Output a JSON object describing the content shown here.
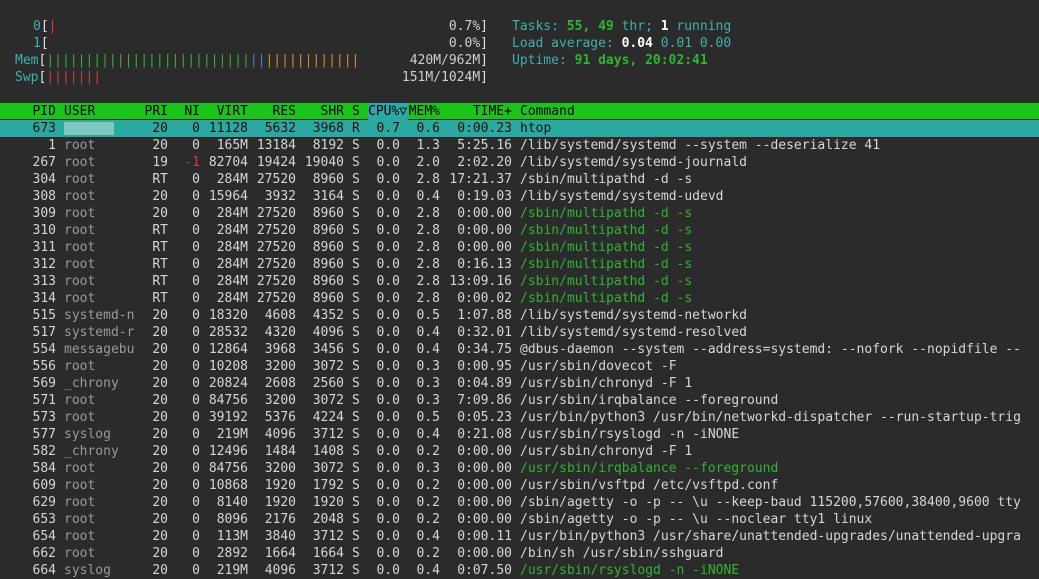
{
  "meters": {
    "cpu0": {
      "label": "0",
      "bar": "|",
      "value": "0.7%"
    },
    "cpu1": {
      "label": "1",
      "bar": "",
      "value": "0.0%"
    },
    "mem": {
      "label": "Mem",
      "bar_green": "||||||||||||||||||||||||||",
      "bar_blue": "||",
      "bar_orange": "||||||||||||",
      "value": "420M/962M"
    },
    "swp": {
      "label": "Swp",
      "bar": "|||||||",
      "value": "151M/1024M"
    }
  },
  "summary": {
    "tasks_label": "Tasks:",
    "tasks": "55,",
    "thr": "49",
    "thr_label": "thr;",
    "running": "1",
    "running_label": "running",
    "load_label": "Load average:",
    "load1": "0.04",
    "load5": "0.01",
    "load15": "0.00",
    "uptime_label": "Uptime:",
    "uptime": "91 days, 20:02:41"
  },
  "columns": {
    "pid": "PID",
    "user": "USER",
    "pri": "PRI",
    "ni": "NI",
    "virt": "VIRT",
    "res": "RES",
    "shr": "SHR",
    "s": "S",
    "cpu": "CPU%▽",
    "mem": "MEM%",
    "time": "TIME+",
    "command": "Command"
  },
  "processes": [
    {
      "pid": "673",
      "user": "",
      "pri": "20",
      "ni": "0",
      "virt": "11128",
      "res": "5632",
      "shr": "3968",
      "s": "R",
      "cpu": "0.7",
      "mem": "0.6",
      "time": "0:00.23",
      "cmd": "htop",
      "selected": true
    },
    {
      "pid": "1",
      "user": "root",
      "pri": "20",
      "ni": "0",
      "virt": "165M",
      "res": "13184",
      "shr": "8192",
      "s": "S",
      "cpu": "0.0",
      "mem": "1.3",
      "time": "5:25.16",
      "cmd": "/lib/systemd/systemd --system --deserialize 41"
    },
    {
      "pid": "267",
      "user": "root",
      "pri": "19",
      "ni": "-1",
      "virt": "82704",
      "res": "19424",
      "shr": "19040",
      "s": "S",
      "cpu": "0.0",
      "mem": "2.0",
      "time": "2:02.20",
      "cmd": "/lib/systemd/systemd-journald"
    },
    {
      "pid": "304",
      "user": "root",
      "pri": "RT",
      "ni": "0",
      "virt": "284M",
      "res": "27520",
      "shr": "8960",
      "s": "S",
      "cpu": "0.0",
      "mem": "2.8",
      "time": "17:21.37",
      "cmd": "/sbin/multipathd -d -s"
    },
    {
      "pid": "308",
      "user": "root",
      "pri": "20",
      "ni": "0",
      "virt": "15964",
      "res": "3932",
      "shr": "3164",
      "s": "S",
      "cpu": "0.0",
      "mem": "0.4",
      "time": "0:19.03",
      "cmd": "/lib/systemd/systemd-udevd"
    },
    {
      "pid": "309",
      "user": "root",
      "pri": "20",
      "ni": "0",
      "virt": "284M",
      "res": "27520",
      "shr": "8960",
      "s": "S",
      "cpu": "0.0",
      "mem": "2.8",
      "time": "0:00.00",
      "cmd": "/sbin/multipathd -d -s",
      "thread": true
    },
    {
      "pid": "310",
      "user": "root",
      "pri": "RT",
      "ni": "0",
      "virt": "284M",
      "res": "27520",
      "shr": "8960",
      "s": "S",
      "cpu": "0.0",
      "mem": "2.8",
      "time": "0:00.00",
      "cmd": "/sbin/multipathd -d -s",
      "thread": true
    },
    {
      "pid": "311",
      "user": "root",
      "pri": "RT",
      "ni": "0",
      "virt": "284M",
      "res": "27520",
      "shr": "8960",
      "s": "S",
      "cpu": "0.0",
      "mem": "2.8",
      "time": "0:00.00",
      "cmd": "/sbin/multipathd -d -s",
      "thread": true
    },
    {
      "pid": "312",
      "user": "root",
      "pri": "RT",
      "ni": "0",
      "virt": "284M",
      "res": "27520",
      "shr": "8960",
      "s": "S",
      "cpu": "0.0",
      "mem": "2.8",
      "time": "0:16.13",
      "cmd": "/sbin/multipathd -d -s",
      "thread": true
    },
    {
      "pid": "313",
      "user": "root",
      "pri": "RT",
      "ni": "0",
      "virt": "284M",
      "res": "27520",
      "shr": "8960",
      "s": "S",
      "cpu": "0.0",
      "mem": "2.8",
      "time": "13:09.16",
      "cmd": "/sbin/multipathd -d -s",
      "thread": true
    },
    {
      "pid": "314",
      "user": "root",
      "pri": "RT",
      "ni": "0",
      "virt": "284M",
      "res": "27520",
      "shr": "8960",
      "s": "S",
      "cpu": "0.0",
      "mem": "2.8",
      "time": "0:00.02",
      "cmd": "/sbin/multipathd -d -s",
      "thread": true
    },
    {
      "pid": "515",
      "user": "systemd-n",
      "pri": "20",
      "ni": "0",
      "virt": "18320",
      "res": "4608",
      "shr": "4352",
      "s": "S",
      "cpu": "0.0",
      "mem": "0.5",
      "time": "1:07.88",
      "cmd": "/lib/systemd/systemd-networkd"
    },
    {
      "pid": "517",
      "user": "systemd-r",
      "pri": "20",
      "ni": "0",
      "virt": "28532",
      "res": "4320",
      "shr": "4096",
      "s": "S",
      "cpu": "0.0",
      "mem": "0.4",
      "time": "0:32.01",
      "cmd": "/lib/systemd/systemd-resolved"
    },
    {
      "pid": "554",
      "user": "messagebu",
      "pri": "20",
      "ni": "0",
      "virt": "12864",
      "res": "3968",
      "shr": "3456",
      "s": "S",
      "cpu": "0.0",
      "mem": "0.4",
      "time": "0:34.75",
      "cmd": "@dbus-daemon --system --address=systemd: --nofork --nopidfile --"
    },
    {
      "pid": "556",
      "user": "root",
      "pri": "20",
      "ni": "0",
      "virt": "10208",
      "res": "3200",
      "shr": "3072",
      "s": "S",
      "cpu": "0.0",
      "mem": "0.3",
      "time": "0:00.95",
      "cmd": "/usr/sbin/dovecot -F"
    },
    {
      "pid": "569",
      "user": "_chrony",
      "pri": "20",
      "ni": "0",
      "virt": "20824",
      "res": "2608",
      "shr": "2560",
      "s": "S",
      "cpu": "0.0",
      "mem": "0.3",
      "time": "0:04.89",
      "cmd": "/usr/sbin/chronyd -F 1"
    },
    {
      "pid": "571",
      "user": "root",
      "pri": "20",
      "ni": "0",
      "virt": "84756",
      "res": "3200",
      "shr": "3072",
      "s": "S",
      "cpu": "0.0",
      "mem": "0.3",
      "time": "7:09.86",
      "cmd": "/usr/sbin/irqbalance --foreground"
    },
    {
      "pid": "573",
      "user": "root",
      "pri": "20",
      "ni": "0",
      "virt": "39192",
      "res": "5376",
      "shr": "4224",
      "s": "S",
      "cpu": "0.0",
      "mem": "0.5",
      "time": "0:05.23",
      "cmd": "/usr/bin/python3 /usr/bin/networkd-dispatcher --run-startup-trig"
    },
    {
      "pid": "577",
      "user": "syslog",
      "pri": "20",
      "ni": "0",
      "virt": "219M",
      "res": "4096",
      "shr": "3712",
      "s": "S",
      "cpu": "0.0",
      "mem": "0.4",
      "time": "0:21.08",
      "cmd": "/usr/sbin/rsyslogd -n -iNONE"
    },
    {
      "pid": "582",
      "user": "_chrony",
      "pri": "20",
      "ni": "0",
      "virt": "12496",
      "res": "1484",
      "shr": "1408",
      "s": "S",
      "cpu": "0.0",
      "mem": "0.2",
      "time": "0:00.00",
      "cmd": "/usr/sbin/chronyd -F 1"
    },
    {
      "pid": "584",
      "user": "root",
      "pri": "20",
      "ni": "0",
      "virt": "84756",
      "res": "3200",
      "shr": "3072",
      "s": "S",
      "cpu": "0.0",
      "mem": "0.3",
      "time": "0:00.00",
      "cmd": "/usr/sbin/irqbalance --foreground",
      "thread": true
    },
    {
      "pid": "609",
      "user": "root",
      "pri": "20",
      "ni": "0",
      "virt": "10868",
      "res": "1920",
      "shr": "1792",
      "s": "S",
      "cpu": "0.0",
      "mem": "0.2",
      "time": "0:00.00",
      "cmd": "/usr/sbin/vsftpd /etc/vsftpd.conf"
    },
    {
      "pid": "629",
      "user": "root",
      "pri": "20",
      "ni": "0",
      "virt": "8140",
      "res": "1920",
      "shr": "1920",
      "s": "S",
      "cpu": "0.0",
      "mem": "0.2",
      "time": "0:00.00",
      "cmd": "/sbin/agetty -o -p -- \\u --keep-baud 115200,57600,38400,9600 tty"
    },
    {
      "pid": "653",
      "user": "root",
      "pri": "20",
      "ni": "0",
      "virt": "8096",
      "res": "2176",
      "shr": "2048",
      "s": "S",
      "cpu": "0.0",
      "mem": "0.2",
      "time": "0:00.00",
      "cmd": "/sbin/agetty -o -p -- \\u --noclear tty1 linux"
    },
    {
      "pid": "654",
      "user": "root",
      "pri": "20",
      "ni": "0",
      "virt": "113M",
      "res": "3840",
      "shr": "3712",
      "s": "S",
      "cpu": "0.0",
      "mem": "0.4",
      "time": "0:00.11",
      "cmd": "/usr/bin/python3 /usr/share/unattended-upgrades/unattended-upgra"
    },
    {
      "pid": "662",
      "user": "root",
      "pri": "20",
      "ni": "0",
      "virt": "2892",
      "res": "1664",
      "shr": "1664",
      "s": "S",
      "cpu": "0.0",
      "mem": "0.2",
      "time": "0:00.00",
      "cmd": "/bin/sh /usr/sbin/sshguard"
    },
    {
      "pid": "664",
      "user": "syslog",
      "pri": "20",
      "ni": "0",
      "virt": "219M",
      "res": "4096",
      "shr": "3712",
      "s": "S",
      "cpu": "0.0",
      "mem": "0.4",
      "time": "0:07.50",
      "cmd": "/usr/sbin/rsyslogd -n -iNONE",
      "thread": true
    }
  ]
}
